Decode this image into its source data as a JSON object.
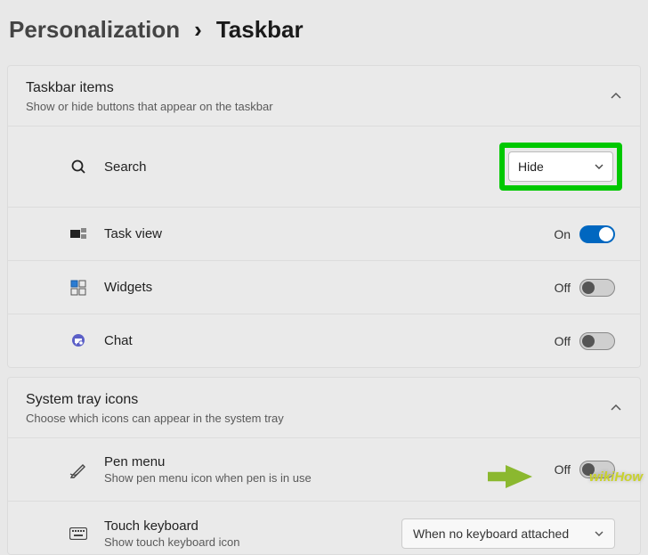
{
  "breadcrumb": {
    "root": "Personalization",
    "current": "Taskbar"
  },
  "sections": {
    "taskbar_items": {
      "title": "Taskbar items",
      "subtitle": "Show or hide buttons that appear on the taskbar",
      "rows": {
        "search": {
          "label": "Search",
          "select_value": "Hide"
        },
        "taskview": {
          "label": "Task view",
          "state": "On"
        },
        "widgets": {
          "label": "Widgets",
          "state": "Off"
        },
        "chat": {
          "label": "Chat",
          "state": "Off"
        }
      }
    },
    "system_tray": {
      "title": "System tray icons",
      "subtitle": "Choose which icons can appear in the system tray",
      "rows": {
        "pen": {
          "label": "Pen menu",
          "sub": "Show pen menu icon when pen is in use",
          "state": "Off"
        },
        "touchkb": {
          "label": "Touch keyboard",
          "sub": "Show touch keyboard icon",
          "select_value": "When no keyboard attached"
        }
      }
    }
  },
  "watermark": "wikiHow"
}
